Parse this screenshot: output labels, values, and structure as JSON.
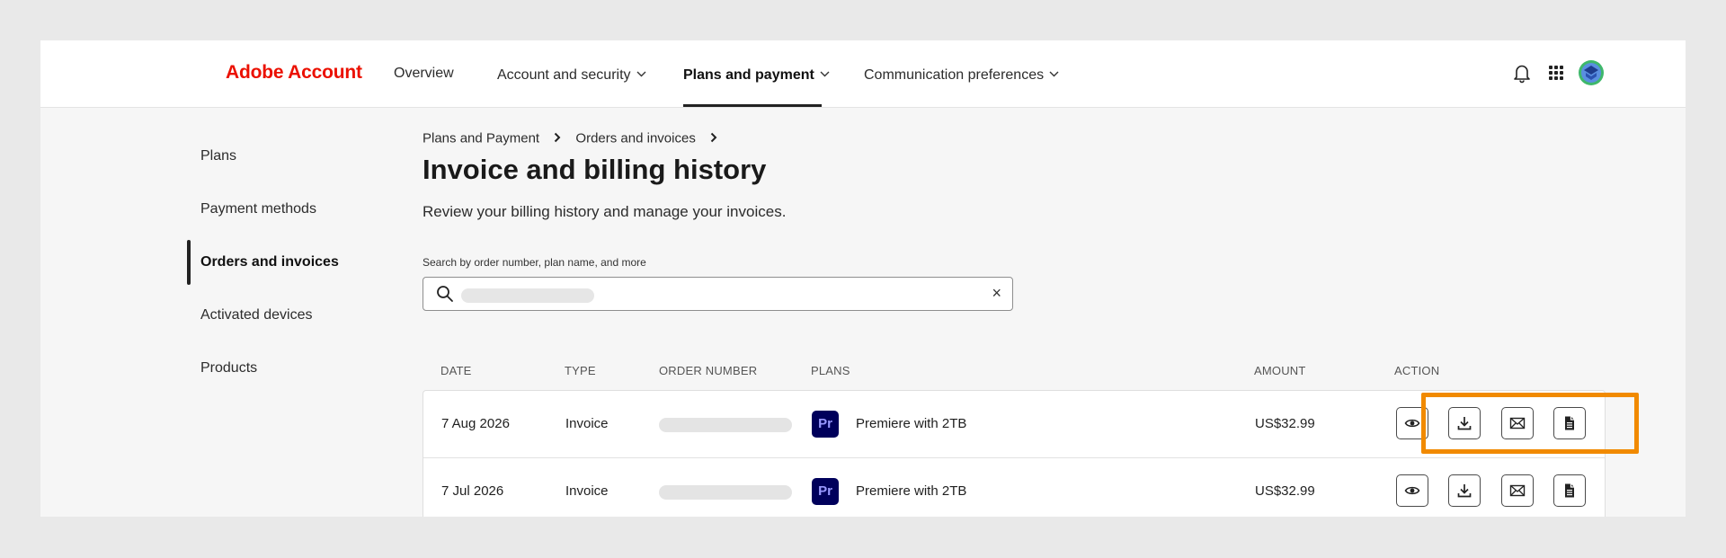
{
  "header": {
    "brand": "Adobe Account",
    "nav": [
      {
        "label": "Overview"
      },
      {
        "label": "Account and security"
      },
      {
        "label": "Plans and payment"
      },
      {
        "label": "Communication preferences"
      }
    ],
    "active_nav": "Plans and payment",
    "icons": [
      "bell-icon",
      "apps-grid-icon",
      "avatar"
    ]
  },
  "sidebar": {
    "items": [
      {
        "label": "Plans"
      },
      {
        "label": "Payment methods"
      },
      {
        "label": "Orders and invoices"
      },
      {
        "label": "Activated devices"
      },
      {
        "label": "Products"
      }
    ],
    "active": "Orders and invoices"
  },
  "breadcrumb": [
    "Plans and Payment",
    "Orders and invoices"
  ],
  "page": {
    "title": "Invoice and billing history",
    "subtitle": "Review your billing history and manage your invoices."
  },
  "search": {
    "label": "Search by order number, plan name, and more",
    "clear_symbol": "×"
  },
  "table": {
    "headers": [
      "DATE",
      "TYPE",
      "ORDER NUMBER",
      "PLANS",
      "AMOUNT",
      "ACTION"
    ],
    "rows": [
      {
        "date": "7 Aug 2026",
        "type": "Invoice",
        "plan_badge": "Pr",
        "plan": "Premiere with 2TB",
        "amount": "US$32.99"
      },
      {
        "date": "7 Jul 2026",
        "type": "Invoice",
        "plan_badge": "Pr",
        "plan": "Premiere with 2TB",
        "amount": "US$32.99"
      }
    ],
    "action_icons": [
      "view-icon",
      "download-icon",
      "email-icon",
      "document-icon"
    ]
  },
  "colors": {
    "brand": "#eb1000",
    "highlight": "#f18a00",
    "premiere_badge_bg": "#00005b",
    "premiere_badge_text": "#9999ff"
  }
}
